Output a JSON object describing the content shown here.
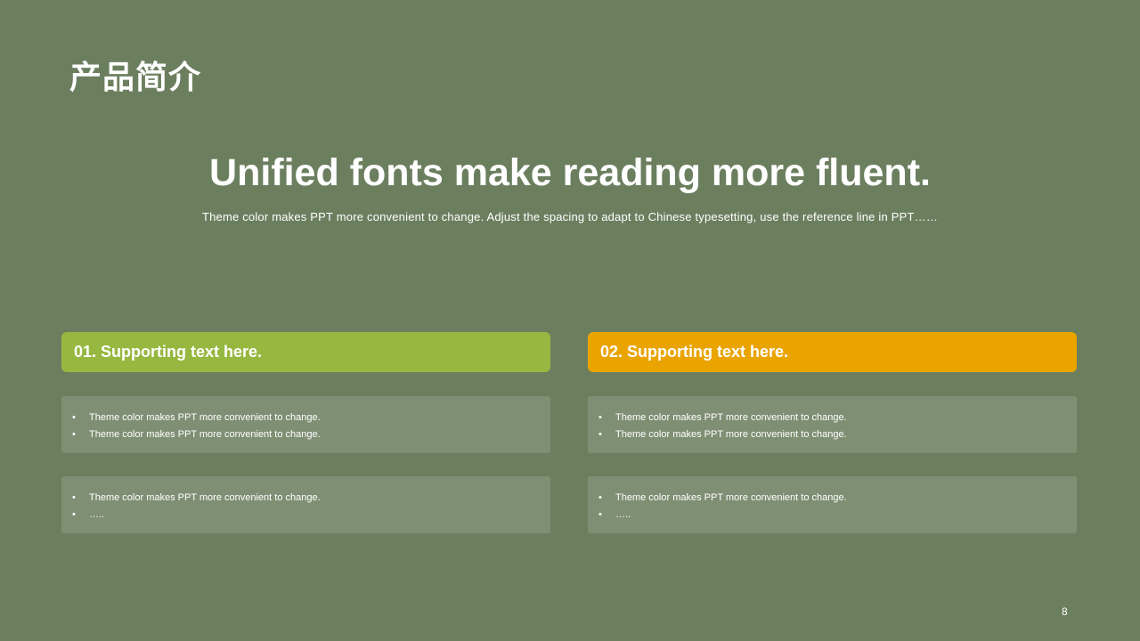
{
  "slide": {
    "title": "产品简介",
    "headline": "Unified fonts make reading more fluent.",
    "subline": "Theme color makes PPT more convenient to change. Adjust the spacing to adapt to Chinese typesetting, use the reference line in PPT……",
    "page_number": "8"
  },
  "colors": {
    "background": "#6b7f5f",
    "accent_green": "#97b840",
    "accent_orange": "#eaa400",
    "box": "#7f8f74"
  },
  "columns": [
    {
      "header": "01. Supporting text here.",
      "box1": {
        "items": [
          "Theme color makes PPT more convenient to change.",
          "Theme color makes PPT more convenient to change."
        ]
      },
      "box2": {
        "items": [
          "Theme color makes PPT more convenient to change.",
          "….."
        ]
      }
    },
    {
      "header": "02. Supporting text here.",
      "box1": {
        "items": [
          "Theme color makes PPT more convenient to change.",
          "Theme color makes PPT more convenient to change."
        ]
      },
      "box2": {
        "items": [
          "Theme color makes PPT more convenient to change.",
          "….."
        ]
      }
    }
  ],
  "bullet_glyph": "•"
}
